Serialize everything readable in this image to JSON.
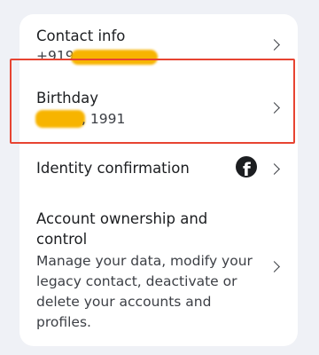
{
  "rows": {
    "contact": {
      "title": "Contact info",
      "value": "+919"
    },
    "birthday": {
      "title": "Birthday",
      "value": ", 1991"
    },
    "identity": {
      "title": "Identity confirmation",
      "icon": "facebook-logo-icon"
    },
    "ownership": {
      "title": "Account ownership and control",
      "description": "Manage your data, modify your legacy contact, deactivate or delete your accounts and profiles."
    }
  },
  "colors": {
    "background": "#eff1f6",
    "card": "#ffffff",
    "highlight": "#e74432",
    "redaction": "#f7b400"
  }
}
